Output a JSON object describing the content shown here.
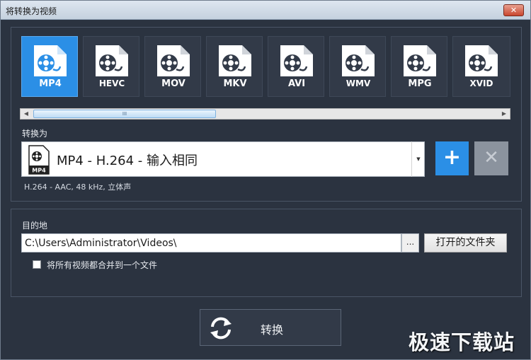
{
  "window": {
    "title": "将转换为视频",
    "close_glyph": "✕"
  },
  "formats": [
    {
      "name": "MP4",
      "selected": true
    },
    {
      "name": "HEVC",
      "selected": false
    },
    {
      "name": "MOV",
      "selected": false
    },
    {
      "name": "MKV",
      "selected": false
    },
    {
      "name": "AVI",
      "selected": false
    },
    {
      "name": "WMV",
      "selected": false
    },
    {
      "name": "MPG",
      "selected": false
    },
    {
      "name": "XVID",
      "selected": false
    }
  ],
  "scrollbar": {
    "left_arrow": "◀",
    "right_arrow": "▶",
    "thumb_grip": "III"
  },
  "convert_to": {
    "label": "转换为",
    "icon_label": "MP4",
    "selected_preset": "MP4 - H.264 - 输入相同",
    "arrow_glyph": "▼",
    "detail": "H.264  -  AAC,  48 kHz,  立体声",
    "add_glyph": "+",
    "remove_glyph": "✕"
  },
  "destination": {
    "label": "目的地",
    "path": "C:\\Users\\Administrator\\Videos\\",
    "browse_label": "...",
    "open_folder_label": "打开的文件夹",
    "merge_label": "将所有视频都合并到一个文件",
    "merge_checked": false
  },
  "convert_button": {
    "label": "转换"
  },
  "watermark": "极速下载站",
  "colors": {
    "accent": "#2b8fe6",
    "background": "#2b3340",
    "tile": "#323a48"
  },
  "icons": {
    "format_tile": "video-file-icon",
    "convert": "refresh-icon"
  }
}
